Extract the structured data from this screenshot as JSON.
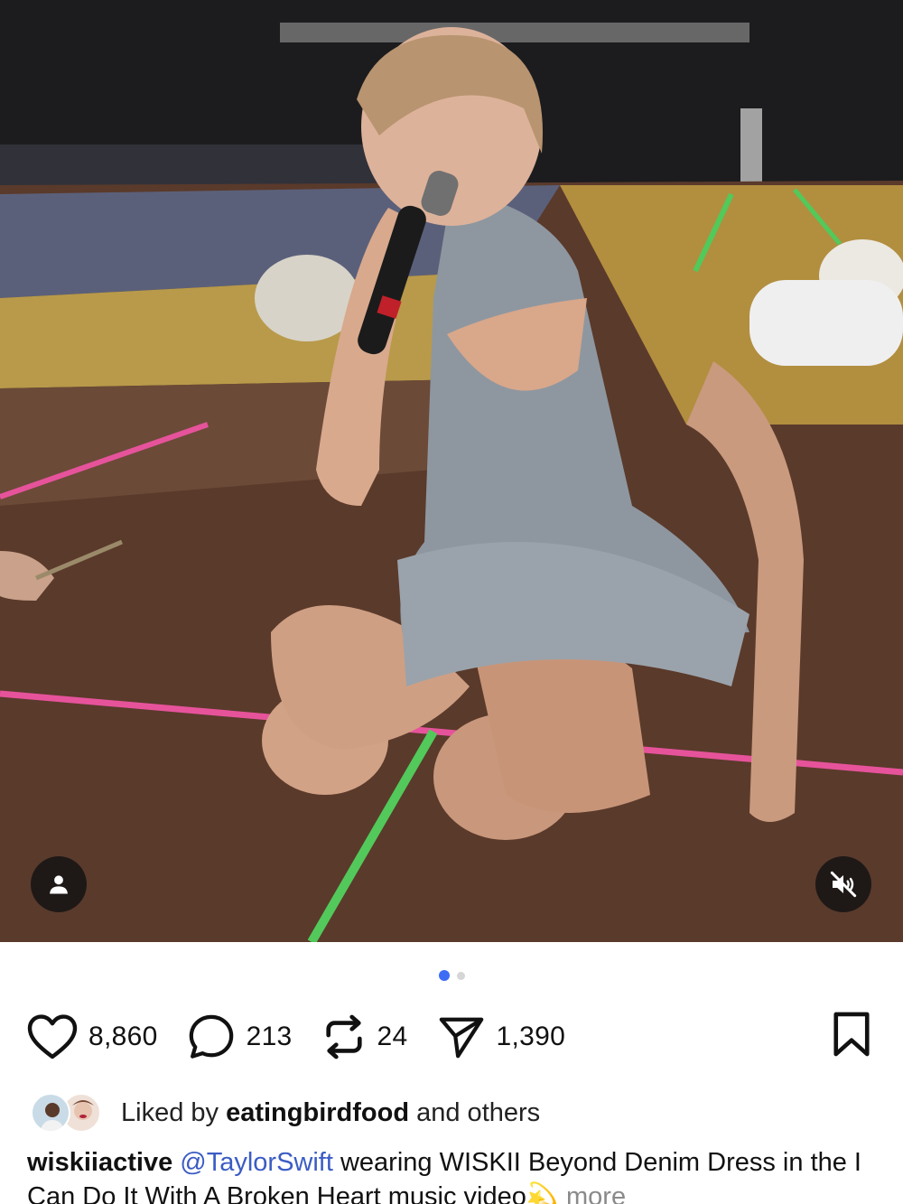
{
  "post": {
    "media": {
      "tag_icon": "person-icon",
      "mute_icon": "speaker-muted-icon"
    },
    "carousel": {
      "total": 2,
      "active": 1
    },
    "actions": {
      "likes": "8,860",
      "comments": "213",
      "reposts": "24",
      "shares": "1,390"
    },
    "liked_by": {
      "prefix": "Liked by ",
      "user": "eatingbirdfood",
      "suffix": " and others"
    },
    "caption": {
      "username": "wiskiiactive",
      "mention": "@TaylorSwift",
      "text": " wearing WISKII Beyond Denim Dress in the I Can Do It With A Broken Heart music video",
      "emoji": "💫",
      "more": "more"
    }
  },
  "colors": {
    "mention": "#3b5cc4",
    "carousel_active": "#3d6cf5",
    "carousel_inactive": "#d6d6d6"
  }
}
